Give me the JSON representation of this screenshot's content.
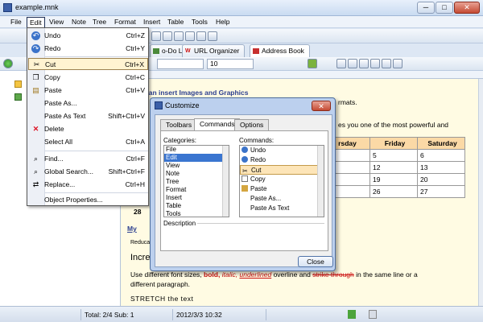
{
  "window": {
    "title": "example.mnk",
    "minimize": "─",
    "maximize": "□",
    "close": "✕"
  },
  "menubar": [
    "File",
    "Edit",
    "View",
    "Note",
    "Tree",
    "Format",
    "Insert",
    "Table",
    "Tools",
    "Help"
  ],
  "tabs": [
    "W",
    "o-Do List",
    "URL Organizer",
    "Address Book"
  ],
  "font_size": "10",
  "edit_menu": {
    "items": [
      {
        "label": "Undo",
        "shortcut": "Ctrl+Z"
      },
      {
        "label": "Redo",
        "shortcut": "Ctrl+Y"
      },
      {
        "label": "Cut",
        "shortcut": "Ctrl+X"
      },
      {
        "label": "Copy",
        "shortcut": "Ctrl+C"
      },
      {
        "label": "Paste",
        "shortcut": "Ctrl+V"
      },
      {
        "label": "Paste As...",
        "shortcut": ""
      },
      {
        "label": "Paste As Text",
        "shortcut": "Shift+Ctrl+V"
      },
      {
        "label": "Delete",
        "shortcut": ""
      },
      {
        "label": "Select All",
        "shortcut": "Ctrl+A"
      },
      {
        "label": "Find...",
        "shortcut": "Ctrl+F"
      },
      {
        "label": "Global Search...",
        "shortcut": "Shift+Ctrl+F"
      },
      {
        "label": "Replace...",
        "shortcut": "Ctrl+H"
      },
      {
        "label": "Object Properties...",
        "shortcut": ""
      }
    ]
  },
  "dialog": {
    "title": "Customize",
    "tabs": [
      "Toolbars",
      "Commands",
      "Options"
    ],
    "categories_label": "Categories:",
    "commands_label": "Commands:",
    "categories": [
      "File",
      "Edit",
      "View",
      "Note",
      "Tree",
      "Format",
      "Insert",
      "Table",
      "Tools"
    ],
    "commands": [
      "Undo",
      "Redo",
      "Cut",
      "Copy",
      "Paste",
      "Paste As...",
      "Paste As Text"
    ],
    "description_label": "Description",
    "close_label": "Close"
  },
  "editor": {
    "heading": "can insert Images and Graphics",
    "line1": "rmats.",
    "line2": "es you one of the most powerful and",
    "side_28": "28",
    "mylink": "My",
    "reduce": "Reduca",
    "incre": "Incre",
    "font_demo_1": "Use different font sizes,",
    "font_demo_bold": "bold,",
    "font_demo_italic": "italic,",
    "font_demo_underline": "underlined",
    "font_demo_overline": "overline and",
    "font_demo_strike": "strike through",
    "font_demo_2": "in the same line or a",
    "font_demo_3": "different paragraph.",
    "stretch": "STRETCH the text"
  },
  "calendar": {
    "headers": [
      "rsday",
      "Friday",
      "Saturday"
    ],
    "rows": [
      [
        "",
        "5",
        "6"
      ],
      [
        "",
        "12",
        "13"
      ],
      [
        "",
        "19",
        "20"
      ],
      [
        "",
        "26",
        "27"
      ]
    ]
  },
  "status": {
    "total": "Total: 2/4  Sub: 1",
    "date": "2012/3/3 10:32"
  }
}
